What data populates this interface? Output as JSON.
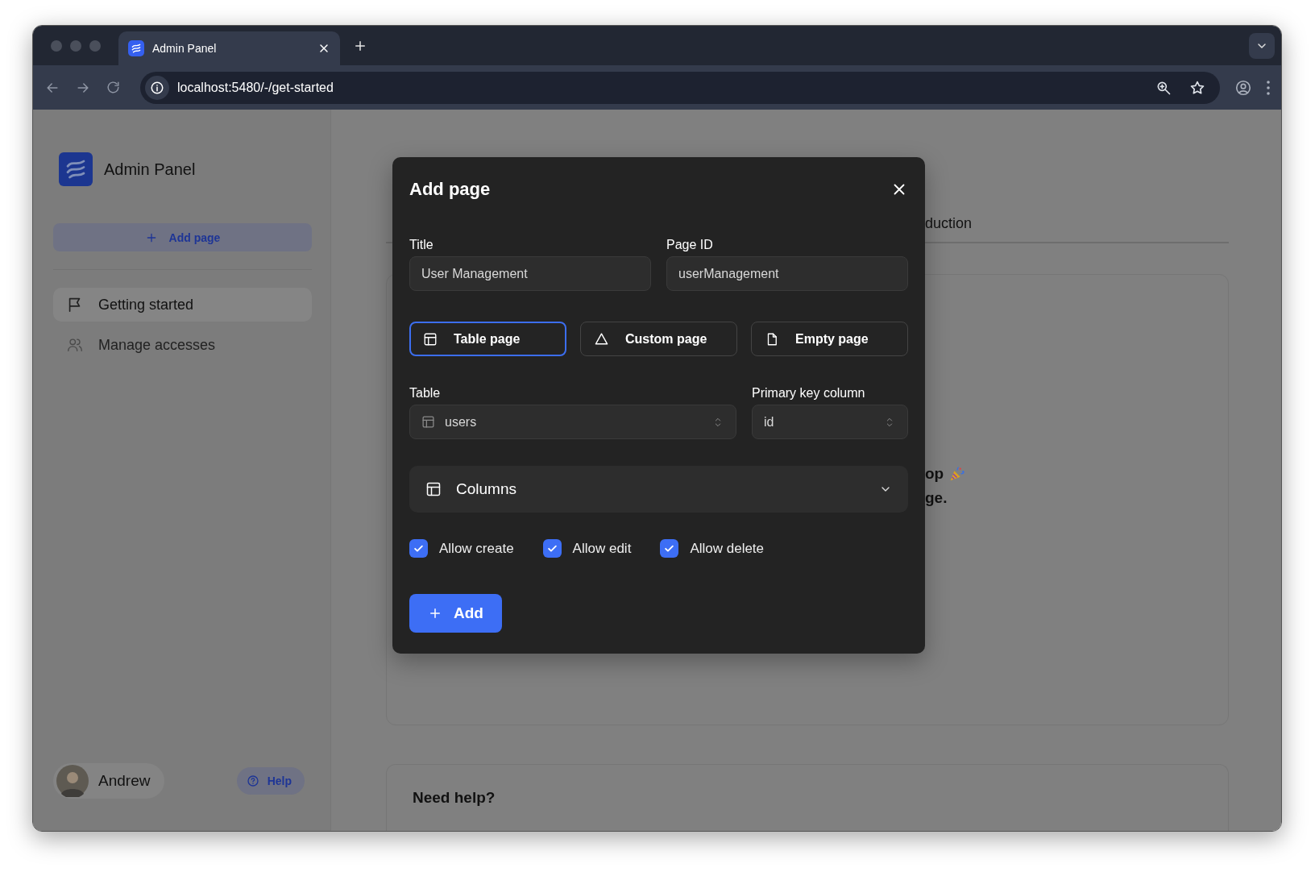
{
  "browser": {
    "tab_title": "Admin Panel",
    "address": "localhost:5480/-/get-started"
  },
  "sidebar": {
    "app_name": "Admin Panel",
    "add_button": "Add page",
    "items": [
      {
        "label": "Getting started",
        "selected": true
      },
      {
        "label": "Manage accesses",
        "selected": false
      }
    ],
    "user": {
      "name": "Andrew"
    },
    "help_button": "Help"
  },
  "main": {
    "tab_fragment": "duction",
    "card_lines": [
      "op",
      "ge."
    ],
    "help_card": {
      "title": "Need help?"
    }
  },
  "dialog": {
    "title": "Add page",
    "fields": [
      {
        "label": "Title",
        "value": "User Management"
      },
      {
        "label": "Page ID",
        "value": "userManagement"
      }
    ],
    "page_types": [
      {
        "kind": "table",
        "label": "Table page",
        "selected": true
      },
      {
        "kind": "custom",
        "label": "Custom page",
        "selected": false
      },
      {
        "kind": "empty",
        "label": "Empty page",
        "selected": false
      }
    ],
    "selects": [
      {
        "kind": "table",
        "label": "Table",
        "value": "users"
      },
      {
        "kind": "plain",
        "label": "Primary key column",
        "value": "id"
      }
    ],
    "columns_section": {
      "label": "Columns",
      "expanded": false
    },
    "checkboxes": [
      {
        "label": "Allow create",
        "checked": true
      },
      {
        "label": "Allow edit",
        "checked": true
      },
      {
        "label": "Allow delete",
        "checked": true
      }
    ],
    "submit": "Add"
  }
}
